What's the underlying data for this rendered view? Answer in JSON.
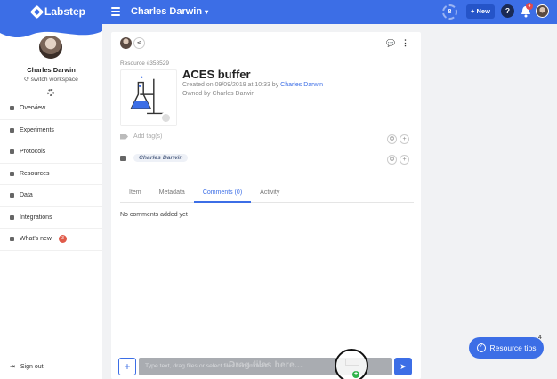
{
  "app": {
    "logo_text": "Labstep",
    "workspace_name": "Charles Darwin"
  },
  "topbar": {
    "progress_count": "8",
    "new_label": "+ New",
    "help_label": "?",
    "notification_count": "4"
  },
  "sidebar": {
    "user_name": "Charles Darwin",
    "switch_label": "switch workspace",
    "items": [
      {
        "label": "Overview",
        "icon": "home-icon"
      },
      {
        "label": "Experiments",
        "icon": "experiments-icon"
      },
      {
        "label": "Protocols",
        "icon": "protocols-icon"
      },
      {
        "label": "Resources",
        "icon": "resources-icon"
      },
      {
        "label": "Data",
        "icon": "data-icon"
      },
      {
        "label": "Integrations",
        "icon": "integrations-icon"
      },
      {
        "label": "What's new",
        "icon": "megaphone-icon",
        "count": "3"
      }
    ],
    "signout_label": "Sign out"
  },
  "resource": {
    "id_label": "Resource #358529",
    "title": "ACES buffer",
    "created_text": "Created on 09/09/2019 at 10:33 by ",
    "created_by": "Charles Darwin",
    "owned_text": "Owned by Charles Darwin",
    "add_tag_label": "Add tag(s)",
    "permission_chip": "Charles Darwin"
  },
  "tabs": [
    {
      "label": "Item",
      "active": false
    },
    {
      "label": "Metadata",
      "active": false
    },
    {
      "label": "Comments (0)",
      "active": true
    },
    {
      "label": "Activity",
      "active": false
    }
  ],
  "comments": {
    "empty_text": "No comments added yet",
    "input_placeholder": "Type text, drag files or select files to comment",
    "drag_label": "Drag files here..."
  },
  "tips": {
    "label": "Resource tips",
    "count": "4"
  }
}
